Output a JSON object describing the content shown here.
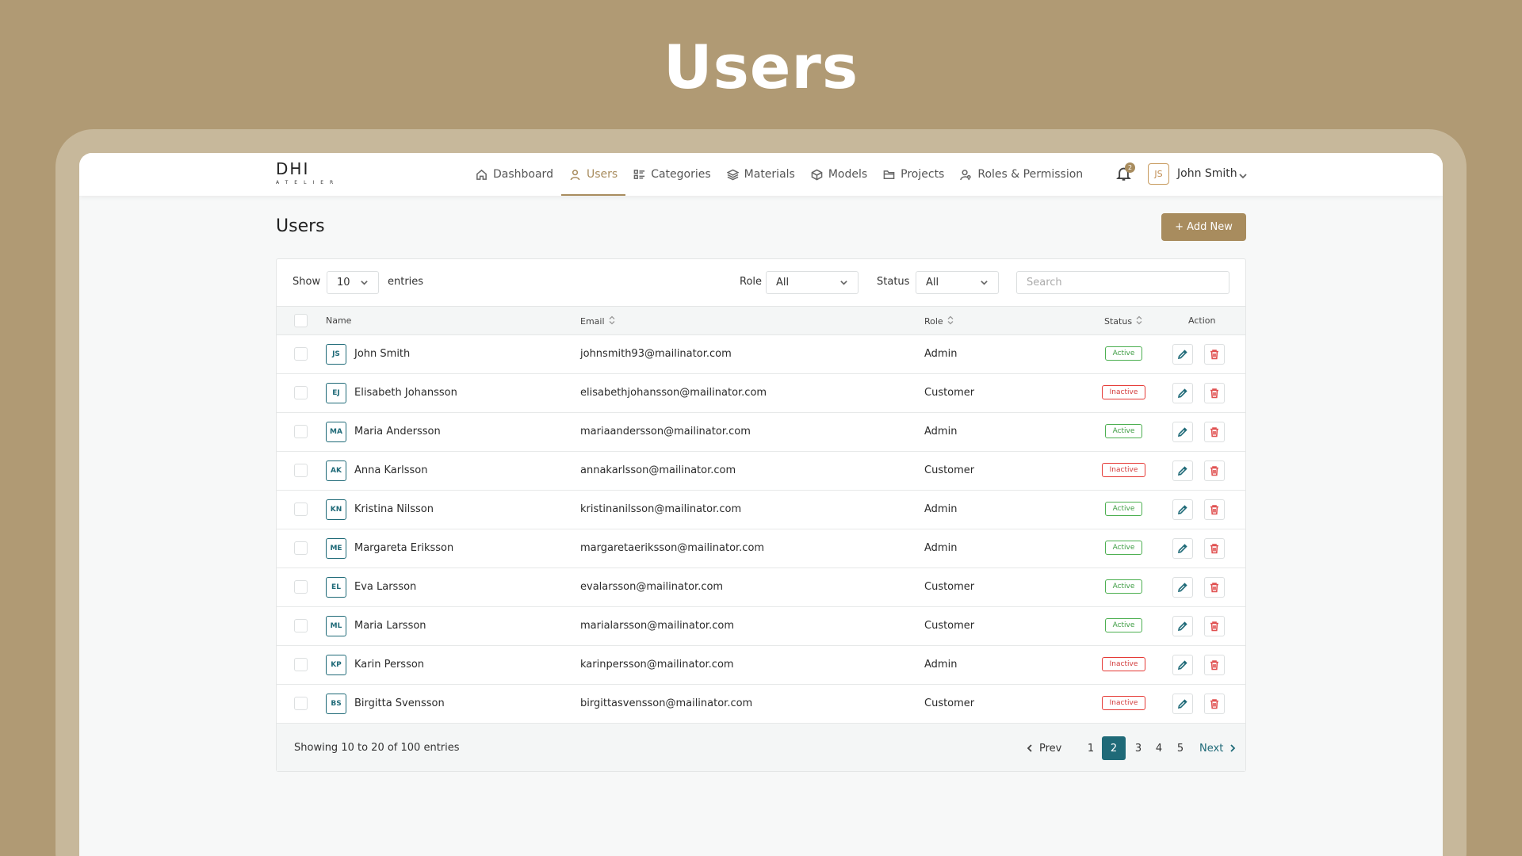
{
  "hero_title": "Users",
  "logo": {
    "main": "DHI",
    "sub": "ATELIER"
  },
  "nav": [
    {
      "label": "Dashboard",
      "icon": "home-icon"
    },
    {
      "label": "Users",
      "icon": "user-icon",
      "active": true
    },
    {
      "label": "Categories",
      "icon": "categories-icon"
    },
    {
      "label": "Materials",
      "icon": "layers-icon"
    },
    {
      "label": "Models",
      "icon": "cube-icon"
    },
    {
      "label": "Projects",
      "icon": "folder-icon"
    },
    {
      "label": "Roles & Permission",
      "icon": "user-key-icon"
    }
  ],
  "header": {
    "notification_count": "2",
    "avatar_initials": "JS",
    "user_name": "John Smith"
  },
  "page": {
    "title": "Users",
    "add_button": "+ Add New"
  },
  "toolbar": {
    "show_label": "Show",
    "show_value": "10",
    "entries_label": "entries",
    "role_label": "Role",
    "role_value": "All",
    "status_label": "Status",
    "status_value": "All",
    "search_placeholder": "Search"
  },
  "table": {
    "columns": {
      "name": "Name",
      "email": "Email",
      "role": "Role",
      "status": "Status",
      "action": "Action"
    },
    "rows": [
      {
        "initials": "JS",
        "name": "John Smith",
        "email": "johnsmith93@mailinator.com",
        "role": "Admin",
        "status": "Active"
      },
      {
        "initials": "EJ",
        "name": "Elisabeth Johansson",
        "email": "elisabethjohansson@mailinator.com",
        "role": "Customer",
        "status": "Inactive"
      },
      {
        "initials": "MA",
        "name": "Maria Andersson",
        "email": "mariaandersson@mailinator.com",
        "role": "Admin",
        "status": "Active"
      },
      {
        "initials": "AK",
        "name": "Anna Karlsson",
        "email": "annakarlsson@mailinator.com",
        "role": "Customer",
        "status": "Inactive"
      },
      {
        "initials": "KN",
        "name": "Kristina Nilsson",
        "email": "kristinanilsson@mailinator.com",
        "role": "Admin",
        "status": "Active"
      },
      {
        "initials": "ME",
        "name": "Margareta Eriksson",
        "email": "margaretaeriksson@mailinator.com",
        "role": "Admin",
        "status": "Active"
      },
      {
        "initials": "EL",
        "name": "Eva Larsson",
        "email": "evalarsson@mailinator.com",
        "role": "Customer",
        "status": "Active"
      },
      {
        "initials": "ML",
        "name": "Maria Larsson",
        "email": "marialarsson@mailinator.com",
        "role": "Customer",
        "status": "Active"
      },
      {
        "initials": "KP",
        "name": "Karin Persson",
        "email": "karinpersson@mailinator.com",
        "role": "Admin",
        "status": "Inactive"
      },
      {
        "initials": "BS",
        "name": "Birgitta Svensson",
        "email": "birgittasvensson@mailinator.com",
        "role": "Customer",
        "status": "Inactive"
      }
    ]
  },
  "pagination": {
    "summary": "Showing 10 to 20 of 100 entries",
    "prev": "Prev",
    "next": "Next",
    "pages": [
      "1",
      "2",
      "3",
      "4",
      "5"
    ],
    "current": "2"
  },
  "colors": {
    "accent": "#a88c5e",
    "teal": "#1f6a78",
    "active": "#4caf50",
    "inactive": "#e53935"
  }
}
